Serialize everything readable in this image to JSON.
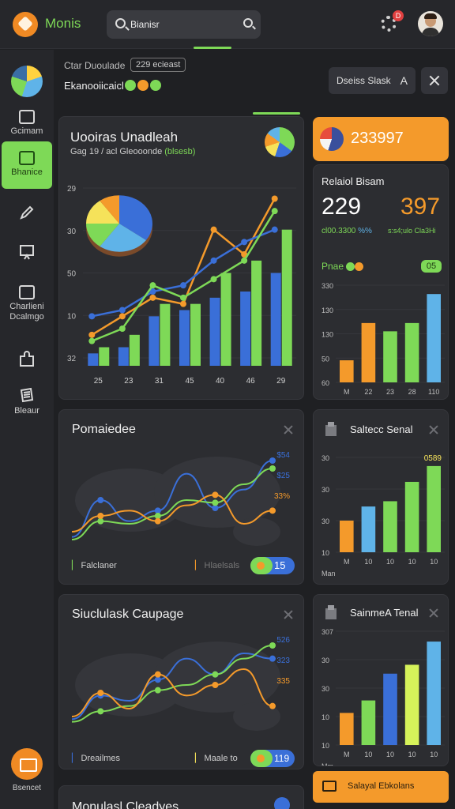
{
  "app": {
    "name": "Monis",
    "search_value": "Bianisr",
    "notification_count": "D"
  },
  "sidebar": {
    "items": [
      {
        "label": "Gcimam"
      },
      {
        "label": "Bhanice"
      },
      {
        "label": ""
      },
      {
        "label": ""
      },
      {
        "label": "Charlieni\nDcalmgo"
      },
      {
        "label": ""
      },
      {
        "label": "Bleaur"
      }
    ],
    "bottom_label": "Bsencet"
  },
  "header": {
    "title": "Ctar Duoulade",
    "count": "229 ecieast",
    "subtitle": "Ekanooiicaicl",
    "button_label": "Dseiss Slask",
    "button_arrow": "A"
  },
  "colors": {
    "green": "#7ed957",
    "orange": "#f49a2b",
    "blue": "#3a6fd8",
    "light_blue": "#5fb3e8",
    "yellow": "#f5e25a"
  },
  "cards": {
    "main": {
      "title": "Uooiras Unadleah",
      "subtitle": "Gag 19 / acl Gleooonde",
      "subtitle_tag": "(blsesb)"
    },
    "stats": {
      "value": "233997",
      "title": "Relaiol Bisam",
      "metric_left": "229",
      "metric_left_caption": "cl00.3300",
      "metric_left_caption_tag": "%%",
      "metric_right": "397",
      "metric_right_caption": "s:s4;ulo Cla3Hi",
      "row_label": "Pnae",
      "row_badge": "05"
    },
    "world1": {
      "title": "Pomaiedee",
      "legend_left": "Falclaner",
      "legend_right": "Hlaelsals",
      "badge": "15"
    },
    "side1": {
      "title": "Saltecc Senal"
    },
    "world2": {
      "title": "Siuclulask Caupage",
      "legend_left": "Dreailmes",
      "legend_right": "Maale to",
      "badge": "119"
    },
    "side2": {
      "title": "SainmeA Tenal"
    },
    "bottom": {
      "title": "Monulasl Cleadyes",
      "summary_label": "Salayal Ebkolans"
    }
  },
  "chart_data": [
    {
      "type": "bar",
      "id": "main-combo",
      "categories": [
        "25",
        "23",
        "31",
        "45",
        "40",
        "46",
        "29"
      ],
      "y_ticks": [
        "29",
        "30",
        "50",
        "10",
        "32"
      ],
      "series": [
        {
          "values": [
            2,
            3,
            8,
            9,
            11,
            12,
            15
          ],
          "color": "#3a6fd8"
        },
        {
          "values": [
            3,
            5,
            10,
            10,
            15,
            17,
            22
          ],
          "color": "#7ed957"
        }
      ],
      "lines": [
        {
          "values": [
            5,
            8,
            11,
            10,
            22,
            18,
            27
          ],
          "color": "#f49a2b"
        },
        {
          "values": [
            8,
            9,
            12,
            13,
            17,
            20,
            22
          ],
          "color": "#3a6fd8"
        },
        {
          "values": [
            4,
            6,
            13,
            11,
            14,
            17,
            25
          ],
          "color": "#7ed957"
        }
      ],
      "pie": [
        {
          "value": 35,
          "color": "#3a6fd8"
        },
        {
          "value": 25,
          "color": "#5fb3e8"
        },
        {
          "value": 15,
          "color": "#7ed957"
        },
        {
          "value": 15,
          "color": "#f5e25a"
        },
        {
          "value": 10,
          "color": "#f49a2b"
        }
      ]
    },
    {
      "type": "bar",
      "id": "stats-bars",
      "categories": [
        "M",
        "22",
        "23",
        "28",
        "110"
      ],
      "y_ticks": [
        "330",
        "130",
        "130",
        "50",
        "60"
      ],
      "values": [
        16,
        43,
        37,
        43,
        64
      ],
      "colors": [
        "#f49a2b",
        "#f49a2b",
        "#7ed957",
        "#7ed957",
        "#5fb3e8"
      ]
    },
    {
      "type": "bar",
      "id": "side1-bars",
      "categories": [
        "M",
        "10",
        "10",
        "10",
        "10"
      ],
      "y_ticks": [
        "30",
        "30",
        "30",
        "10"
      ],
      "values": [
        18,
        26,
        29,
        40,
        49
      ],
      "colors": [
        "#f49a2b",
        "#5fb3e8",
        "#7ed957",
        "#7ed957",
        "#7ed957"
      ],
      "annotation": "0589",
      "xlabel": "Man"
    },
    {
      "type": "bar",
      "id": "side2-bars",
      "categories": [
        "M",
        "10",
        "10",
        "10",
        "10"
      ],
      "y_ticks": [
        "307",
        "30",
        "30",
        "10",
        "10"
      ],
      "values": [
        18,
        25,
        40,
        45,
        58
      ],
      "colors": [
        "#f49a2b",
        "#7ed957",
        "#3a6fd8",
        "#d6f25a",
        "#5fb3e8"
      ],
      "xlabel": "Mm"
    },
    {
      "type": "line",
      "id": "world1-lines",
      "labels": [
        "$54",
        "$25",
        "33%"
      ],
      "series": [
        {
          "values": [
            4,
            18,
            10,
            14,
            28,
            15,
            22,
            33
          ],
          "color": "#3a6fd8"
        },
        {
          "values": [
            3,
            10,
            9,
            12,
            18,
            17,
            24,
            30
          ],
          "color": "#7ed957"
        },
        {
          "values": [
            6,
            12,
            14,
            10,
            16,
            20,
            9,
            14
          ],
          "color": "#f49a2b"
        }
      ]
    },
    {
      "type": "line",
      "id": "world2-lines",
      "labels": [
        "526",
        "323",
        "335"
      ],
      "series": [
        {
          "values": [
            5,
            14,
            12,
            20,
            28,
            22,
            30,
            28
          ],
          "color": "#3a6fd8"
        },
        {
          "values": [
            4,
            8,
            10,
            16,
            18,
            22,
            28,
            33
          ],
          "color": "#7ed957"
        },
        {
          "values": [
            6,
            15,
            9,
            22,
            14,
            18,
            24,
            10
          ],
          "color": "#f49a2b"
        }
      ]
    }
  ]
}
